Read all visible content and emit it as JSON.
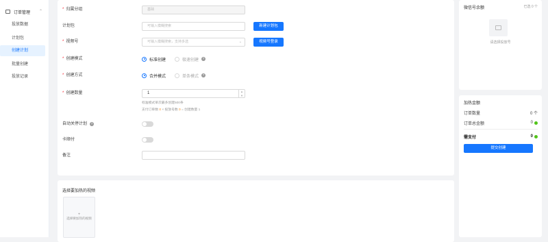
{
  "sidebar": {
    "group": "订单管理",
    "items": [
      {
        "label": "投放数据"
      },
      {
        "label": "计划包"
      },
      {
        "label": "创建计划"
      },
      {
        "label": "批量创建"
      },
      {
        "label": "投放记录"
      }
    ]
  },
  "form": {
    "group": {
      "label": "归属分组",
      "value": "基础"
    },
    "plan_pack": {
      "label": "计划包",
      "placeholder": "可输入模糊搜索",
      "button": "新建计划包"
    },
    "video": {
      "label": "视频号",
      "placeholder": "可输入模糊搜索，支持多选",
      "button": "视频号登录"
    },
    "create_mode": {
      "label": "创建模式",
      "options": [
        "标准创建",
        "极速创建"
      ]
    },
    "create_way": {
      "label": "创建方式",
      "options": [
        "合并模式",
        "单条模式"
      ]
    },
    "count": {
      "label": "创建数量",
      "value": "1",
      "note1": "标准模式单次最多创建500条",
      "note2_a": "支付订单数",
      "note2_b": "0",
      "note2_c": " × 投放号数",
      "note2_d": "0",
      "note2_e": " = 创建数量 1"
    },
    "auto_close": {
      "label": "自动关停计划"
    },
    "card": {
      "label": "卡顺付"
    },
    "remark": {
      "label": "备注"
    }
  },
  "videos": {
    "title": "选择要加热的视频",
    "add_label": "选择要加热的视频",
    "plus": "+"
  },
  "right": {
    "title": "微信号余额",
    "selected": "已选 0 个",
    "placeholder": "请选择投放号",
    "summary": {
      "title": "加热金额",
      "order_count_label": "订单数量",
      "order_count": "0 个",
      "total_label": "订单总金额",
      "total": "0",
      "pay_label": "需支付",
      "pay": "0",
      "submit": "提交创建"
    }
  },
  "colors": {
    "primary": "#1677ff",
    "required": "#f5222d",
    "coin": "#52c41a"
  }
}
